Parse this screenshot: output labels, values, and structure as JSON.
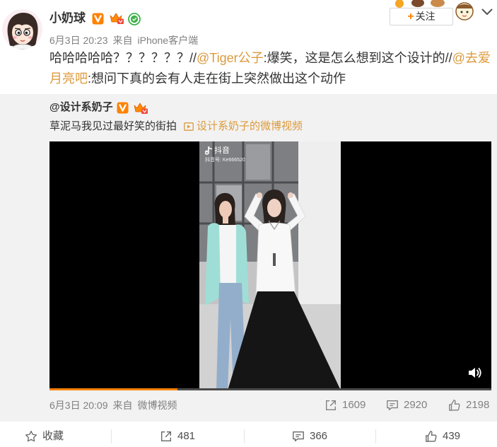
{
  "colors": {
    "link": "#dc9a3c",
    "accent": "#ff8200",
    "meta_text": "#808080",
    "repost_bg": "#f2f2f2"
  },
  "post": {
    "author": {
      "name": "小奶球",
      "avatar_icon": "cartoon-avatar",
      "badges": [
        "verified-v-icon",
        "vip-icon",
        "green-check-icon"
      ]
    },
    "meta": {
      "date": "6月3日 20:23",
      "source_prefix": "来自",
      "source": "iPhone客户端"
    },
    "follow_button": {
      "plus": "+",
      "label": "关注"
    },
    "menu_icon": "chevron-down-icon",
    "text": [
      "哈哈哈哈哈？？？？？？//",
      "@Tiger公子",
      ":爆笑，这是怎么想到这个设计的//",
      "@去爱月亮吧",
      ":想问下真的会有人走在街上突然做出这个动作"
    ]
  },
  "repost": {
    "author": {
      "name": "@设计系奶子",
      "badges": [
        "verified-v-icon",
        "vip-icon"
      ]
    },
    "text": "草泥马我见过最好笑的街拍",
    "video_link": {
      "icon": "video-icon",
      "label": "设计系奶子的微博视频"
    },
    "video": {
      "watermark": "抖音",
      "account": "抖音号: Ke666520",
      "progress": 0.29,
      "volume_icon": "volume-icon"
    },
    "meta": {
      "date": "6月3日 20:09",
      "source_prefix": "来自",
      "source": "微博视频"
    },
    "stats": {
      "forward": "1609",
      "comment": "2920",
      "like": "2198"
    }
  },
  "actions": {
    "collect": "收藏",
    "forward": "481",
    "comment": "366",
    "like": "439"
  }
}
